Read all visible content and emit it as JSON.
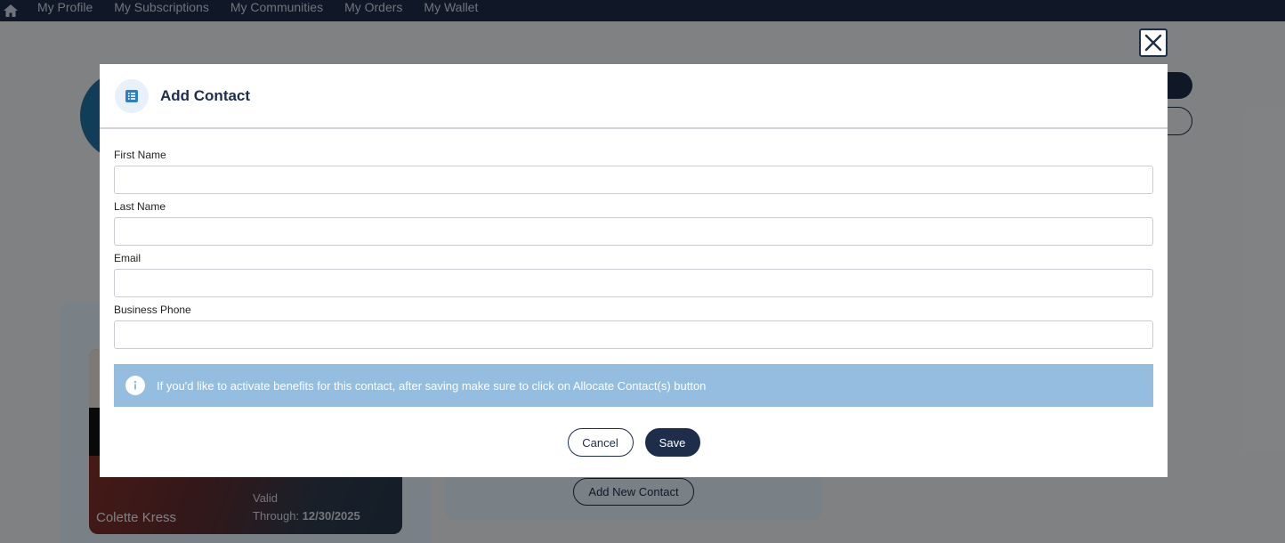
{
  "nav": {
    "items": [
      {
        "label": "My Profile"
      },
      {
        "label": "My Subscriptions"
      },
      {
        "label": "My Communities"
      },
      {
        "label": "My Orders"
      },
      {
        "label": "My Wallet"
      }
    ]
  },
  "background": {
    "card_name": "Colette Kress",
    "valid_label": "Valid",
    "through_label": "Through:",
    "valid_date": "12/30/2025",
    "add_new_contact": "Add New Contact"
  },
  "modal": {
    "title": "Add Contact",
    "fields": {
      "first_name_label": "First Name",
      "first_name_value": "",
      "last_name_label": "Last Name",
      "last_name_value": "",
      "email_label": "Email",
      "email_value": "",
      "phone_label": "Business Phone",
      "phone_value": ""
    },
    "info_text": "If you'd like to activate benefits for this contact, after saving make sure to click on Allocate Contact(s) button",
    "cancel_label": "Cancel",
    "save_label": "Save"
  },
  "colors": {
    "nav_bg": "#1e2d4a",
    "primary": "#1e2d4a",
    "info_bg": "#95bde0"
  },
  "icons": {
    "home": "home-icon",
    "header": "list-icon",
    "info": "info-icon",
    "close": "close-icon"
  }
}
